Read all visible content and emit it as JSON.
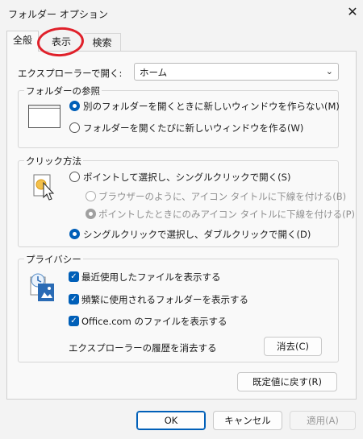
{
  "window": {
    "title": "フォルダー オプション",
    "close_glyph": "✕"
  },
  "tabs": [
    {
      "label": "全般"
    },
    {
      "label": "表示"
    },
    {
      "label": "検索"
    }
  ],
  "open_explorer": {
    "label": "エクスプローラーで開く:",
    "selected": "ホーム"
  },
  "browse_folders": {
    "title": "フォルダーの参照",
    "option_same": "別のフォルダーを開くときに新しいウィンドウを作らない(M)",
    "option_new": "フォルダーを開くたびに新しいウィンドウを作る(W)",
    "selected": "same"
  },
  "click_method": {
    "title": "クリック方法",
    "option_single": "ポイントして選択し、シングルクリックで開く(S)",
    "sub_browser": "ブラウザーのように、アイコン タイトルに下線を付ける(B)",
    "sub_point": "ポイントしたときにのみアイコン タイトルに下線を付ける(P)",
    "option_double": "シングルクリックで選択し、ダブルクリックで開く(D)",
    "selected": "double"
  },
  "privacy": {
    "title": "プライバシー",
    "recent_files": "最近使用したファイルを表示する",
    "frequent_folders": "頻繁に使用されるフォルダーを表示する",
    "office_files": "Office.com のファイルを表示する",
    "clear_history_label": "エクスプローラーの履歴を消去する",
    "clear_button": "消去(C)"
  },
  "restore_defaults": "既定値に戻す(R)",
  "footer": {
    "ok": "OK",
    "cancel": "キャンセル",
    "apply": "適用(A)"
  },
  "colors": {
    "accent": "#005fb8",
    "annotation": "#e0202a"
  }
}
